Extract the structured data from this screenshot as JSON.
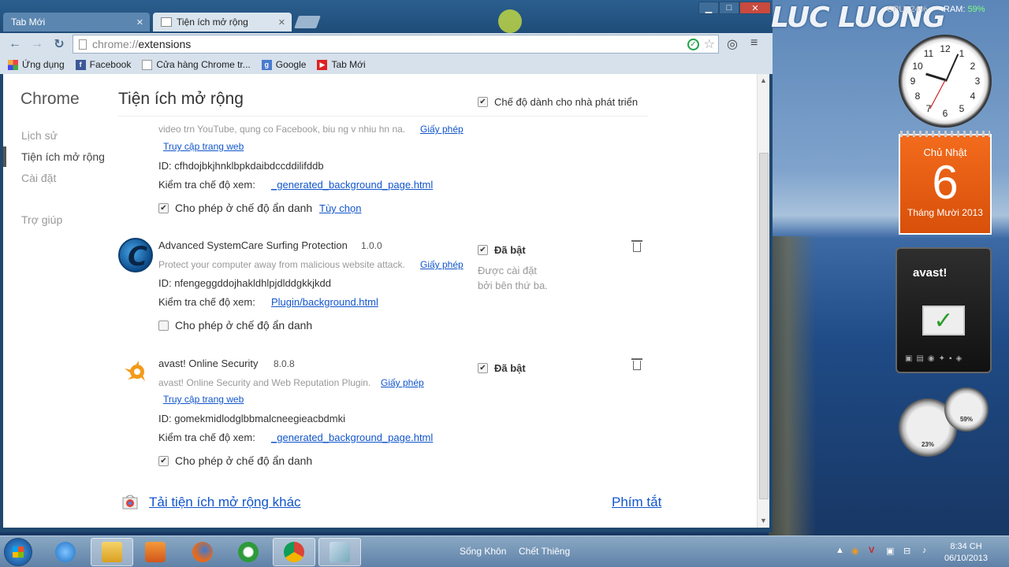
{
  "browser": {
    "tabs": [
      {
        "label": "Tab Mới",
        "active": false
      },
      {
        "label": "Tiện ích mở rộng",
        "active": true
      }
    ],
    "url_scheme": "chrome://",
    "url_path": "extensions",
    "bookmarks": [
      {
        "label": "Ứng dụng",
        "icon": "apps-grid-icon"
      },
      {
        "label": "Facebook",
        "icon": "facebook-icon"
      },
      {
        "label": "Cửa hàng Chrome tr...",
        "icon": "page-icon"
      },
      {
        "label": "Google",
        "icon": "google-icon"
      },
      {
        "label": "Tab Mới",
        "icon": "youtube-icon"
      }
    ]
  },
  "sidebar": {
    "title": "Chrome",
    "items": [
      {
        "label": "Lịch sử"
      },
      {
        "label": "Tiện ích mở rộng"
      },
      {
        "label": "Cài đặt"
      },
      {
        "label": "Trợ giúp"
      }
    ]
  },
  "main": {
    "title": "Tiện ích mở rộng",
    "dev_mode_label": "Chế độ dành cho nhà phát triển",
    "dev_mode_checked": true
  },
  "extensions": [
    {
      "description": "video trn YouTube, qung co Facebook, biu ng v nhiu hn na.",
      "license_label": "Giấy phép",
      "visit_label": "Truy cập trang web",
      "id_text": "ID: cfhdojbkjhnklbpkdaibdccddilifddb",
      "inspect_label": "Kiểm tra chế độ xem:",
      "inspect_link": "_generated_background_page.html",
      "incognito_label": "Cho phép ở chế độ ẩn danh",
      "incognito_checked": true,
      "options_label": "Tùy chọn"
    },
    {
      "name": "Advanced SystemCare Surfing Protection",
      "version": "1.0.0",
      "description": "Protect your computer away from malicious website attack.",
      "license_label": "Giấy phép",
      "id_text": "ID: nfengeggddojhakldhlpjdlddgkkjkdd",
      "inspect_label": "Kiểm tra chế độ xem:",
      "inspect_link": "Plugin/background.html",
      "incognito_label": "Cho phép ở chế độ ẩn danh",
      "incognito_checked": false,
      "enabled_label": "Đã bật",
      "enabled_checked": true,
      "policy_note": "Được cài đặt bởi bên thứ ba."
    },
    {
      "name": "avast! Online Security",
      "version": "8.0.8",
      "description": "avast! Online Security and Web Reputation Plugin.",
      "license_label": "Giấy phép",
      "visit_label": "Truy cập trang web",
      "id_text": "ID: gomekmidlodglbbmalcneegieacbdmki",
      "inspect_label": "Kiểm tra chế độ xem:",
      "inspect_link": "_generated_background_page.html",
      "incognito_label": "Cho phép ở chế độ ẩn danh",
      "incognito_checked": true,
      "enabled_label": "Đã bật",
      "enabled_checked": true
    }
  ],
  "footer": {
    "more_extensions": "Tải tiện ích mở rộng khác",
    "shortcuts": "Phím tắt"
  },
  "taskbar": {
    "items": [
      "Sống Khôn",
      "Chết Thiêng"
    ],
    "time": "8:34 CH",
    "date": "06/10/2013"
  },
  "gadgets": {
    "logo": "LUC LUONG",
    "cpu_label": "CPU: 24%",
    "ram_label": "RAM:",
    "ram_value": "59%",
    "calendar_day": "Chủ Nhật",
    "calendar_date": "6",
    "calendar_month": "Tháng Mười 2013",
    "avast_label": "avast!",
    "gauge1_value": "23%",
    "gauge2_value": "59%"
  },
  "colors": {
    "link": "#1155cc",
    "calendar": "#f36b1c"
  }
}
